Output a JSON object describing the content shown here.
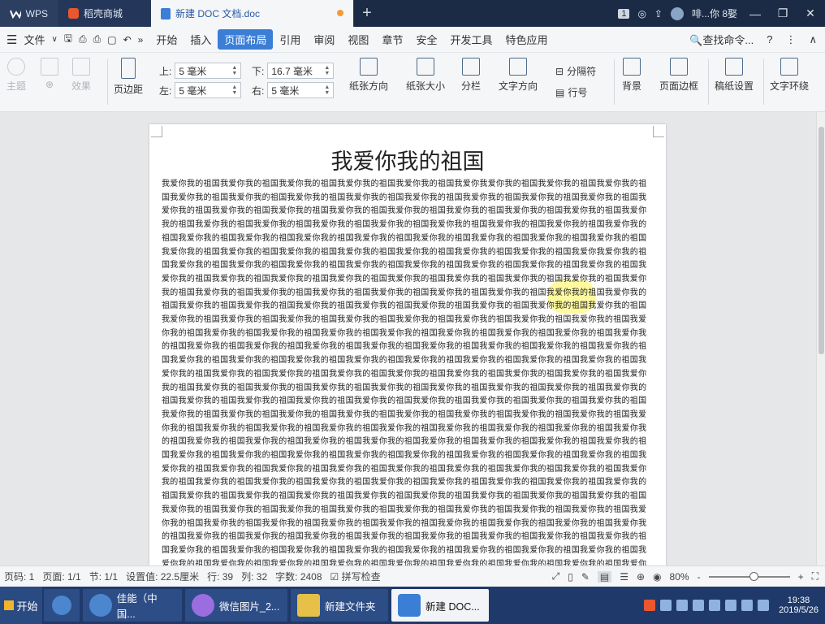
{
  "tabs": {
    "wps": "WPS",
    "shop": "稻壳商城",
    "doc": "新建 DOC 文档.doc",
    "plus": "+"
  },
  "titlebar": {
    "badge": "1",
    "user": "啡...你 8娶",
    "win_min": "—",
    "win_max": "❐",
    "win_close": "✕"
  },
  "menubar": {
    "file": "文件",
    "items": [
      "开始",
      "插入",
      "页面布局",
      "引用",
      "审阅",
      "视图",
      "章节",
      "安全",
      "开发工具",
      "特色应用"
    ],
    "active": "页面布局",
    "search": "查找命令...",
    "help": "?"
  },
  "ribbon": {
    "theme": "主题",
    "font": "",
    "effect": "效果",
    "margins": "页边距",
    "top_label": "上:",
    "top_value": "5 毫米",
    "bottom_label": "下:",
    "bottom_value": "16.7 毫米",
    "left_label": "左:",
    "left_value": "5 毫米",
    "right_label": "右:",
    "right_value": "5 毫米",
    "orientation": "纸张方向",
    "size": "纸张大小",
    "columns": "分栏",
    "text_dir": "文字方向",
    "separator": "分隔符",
    "line_no": "行号",
    "background": "背景",
    "border": "页面边框",
    "grid_paper": "稿纸设置",
    "wrap": "文字环绕"
  },
  "document": {
    "title": "我爱你我的祖国",
    "paragraph": "我爱你我的祖国我爱你我的祖国我爱你我的祖国我爱你我的祖国我爱你我的祖国我爱你我爱你我的祖国我爱你我的祖国我爱你我的祖国我爱你我的祖国我爱你我的祖国我爱你我的祖国我爱你我的祖国我爱你我的祖国我爱你我的祖国我爱你我的祖国我爱你我的祖国我爱你我的祖国我爱你我的祖国我爱你我的祖国我爱你我的祖国我爱你我的祖国我爱你我的祖国我爱你我的祖国我爱你我的祖国我爱你我的祖国我爱你我的祖国我爱你我的祖国我爱你我的祖国我爱你我的祖国我爱你我的祖国我爱你我的祖国我爱你我的祖国我爱你我的祖国我爱你我的祖国我爱你我的祖国我爱你我的祖国我爱你我的祖国我爱你我的祖国我爱你我的祖国我爱你我的祖国我爱你我的祖国我爱你我的祖国我爱你我的祖国我爱你我的祖国我爱你我的祖国我爱你我的祖国我爱你我的祖国我爱你我的祖国我爱你我爱你我的祖国我爱你我的祖国我爱你我的祖国我爱你我的祖国我爱你我的祖国我爱你我的祖国我爱你我的祖国我爱你我的祖国我爱你我的祖国我爱你我的祖国我爱你我的祖国我爱你我的祖国我爱你我的祖国我爱你我的祖国我爱你我的祖国我爱你我的祖国我爱你我的祖国我爱你我的祖国我爱你我的祖国我爱你我的祖国我爱你我的祖国我爱你我的祖国我爱你我的祖国我爱你我的祖国我爱你我的祖国我爱你我的祖国我爱你我的祖国我爱你我的祖国我爱你我的祖国我爱你我的祖国我爱你我的祖国我爱你我的祖国我爱你我的祖国我爱你我的祖国我爱你我的祖国我爱你我的祖国我爱你我的祖国我爱你我的祖国我爱你我的祖国我爱你我的祖国我爱你我的祖国我爱你我的祖国我爱你我的祖国我爱你我的祖国我爱你我的祖国我爱你我的祖国我爱你我的祖国我爱你我的祖国我爱你我的祖国我爱你我的祖国我爱你我的祖国我爱你我的祖国我爱你我的祖国我爱你我的祖国我爱你我的祖国我爱你我的祖国我爱你我的祖国我爱你我的祖国我爱你我的祖国我爱你我的祖国我爱你我的祖国我爱你我的祖国我爱你我的祖国我爱你我的祖国我爱你我的祖国我爱你我的祖国我爱你我的祖国我爱你我的祖国我爱你我的祖国我爱你我的祖国我爱你我的祖国我爱你我的祖国我爱你我的祖国我爱你我的祖国我爱你我的祖国我爱你我的祖国我爱你我的祖国我爱你我的祖国我爱你我的祖国我爱你我的祖国我爱你我的祖国我爱你我的祖国我爱你我的祖国我爱你我的祖国我爱你我的祖国我爱你我的祖国我爱你我的祖国我爱你我的祖国我爱你我的祖国我爱你我的祖国我爱你我的祖国我爱你我的祖国我爱你我的祖国我爱你我的祖国我爱你我的祖国我爱你我的祖国我爱你我的祖国我爱你我的祖国我爱你我的祖国我爱你我的祖国我爱你我的祖国我爱你我的祖国我爱你我的祖国我爱你我的祖国我爱你我的祖国我爱你我的祖国我爱你我的祖国我爱你我的祖国我爱你我的祖国我爱你我的祖国我爱你我的祖国我爱你我的祖国我爱你我的祖国我爱你我的祖国我爱你我的祖国我爱你我的祖国我爱你我的祖国我爱你我的祖国我爱你我的祖国我爱你我的祖国我爱你我的祖国我爱你我的祖国我爱你我的祖国我爱你我的祖国我爱你我的祖国我爱你我的祖国我爱你我的祖国我爱你我的祖国我爱你我的祖国我爱你我的祖国我爱你我的祖国我爱你我的祖国我爱你我的祖国我爱你我的祖国我爱你我的祖国我爱你我的祖国我爱你我的祖国我爱你我的祖国我爱你我的祖国我爱你我的祖国我爱你我的祖国我爱你我的祖国我爱你我的祖国我爱你我的祖国我爱你我的祖国我爱你我的祖国我爱你我的祖国我爱你我的祖国我爱你我的祖国我爱你我的祖国我爱你我的祖国我爱你我的祖国我爱你我的祖国我爱你我的祖国我爱你我的祖国我爱你我的祖国我爱你我的祖国我爱你我的祖国我爱你我的祖国我爱你我的祖国我爱你我的祖国我爱你我的祖国我爱你我的祖国我爱你我的祖国我爱你我的祖国我爱你我的祖国我爱你我的祖国我爱你我的祖国我爱你我的祖国我爱你我的祖国我爱你我的祖国我爱你我的祖国我爱你我的祖国我爱你我的祖国我爱你我的祖国我爱你我的祖国我爱你我的祖国我爱你我的祖国我爱你我的祖国我爱你我的祖国我爱你我的祖国我爱你我的祖国我爱你我的祖国我爱你我的祖国我爱你我的祖国我爱你我的祖国我爱你我的祖国我爱你我的祖国我爱你我的祖国我爱你我的祖国我爱你我的祖国我爱你我的祖国我爱你我的祖国我爱你我的祖国我爱你我的祖国我爱你我的祖国我爱你我的祖国我爱你我的祖国我爱你我的祖国我爱你我的祖国我爱你我的祖国我爱你我的祖国我爱你我的祖国我爱你我的祖国我爱你我的祖国我爱你我的祖国我爱你我的祖国我爱你我的祖国我爱你我的祖国我爱你我的祖国我爱你我的祖国我爱你我的祖国我爱你我的祖国我爱你我的祖国我爱你我的祖国我爱你我的祖国我爱你我的祖国我爱你我的祖国我爱你我的祖国我爱你我的祖国我爱你我的祖国我爱你我的祖国我爱你我的祖国我爱你我的祖国我爱你我的祖国我爱你我的祖国我爱你我的祖国我爱你我的祖国我爱你我的祖国我爱你我的祖国我爱你我的祖国我爱你我的祖国我爱你我的祖国我爱你我的祖国我爱你我的祖国我爱你我的祖国我爱你我的祖国"
  },
  "status": {
    "page_code": "页码: 1",
    "page": "页面: 1/1",
    "section": "节: 1/1",
    "setting": "设置值: 22.5厘米",
    "row": "行: 39",
    "col": "列: 32",
    "words": "字数: 2408",
    "spell": "拼写检查",
    "zoom": "80%",
    "zoom_minus": "-",
    "zoom_plus": "+"
  },
  "taskbar": {
    "start": "开始",
    "items": [
      "佳能（中国...",
      "微信图片_2...",
      "新建文件夹",
      "新建 DOC..."
    ],
    "time": "19:38",
    "date": "2019/5/26"
  },
  "colors": {
    "accent": "#3b7ed6",
    "tab_bg": "#1b2b45",
    "highlight": "#fff650",
    "red_text": "#d62a2a"
  }
}
